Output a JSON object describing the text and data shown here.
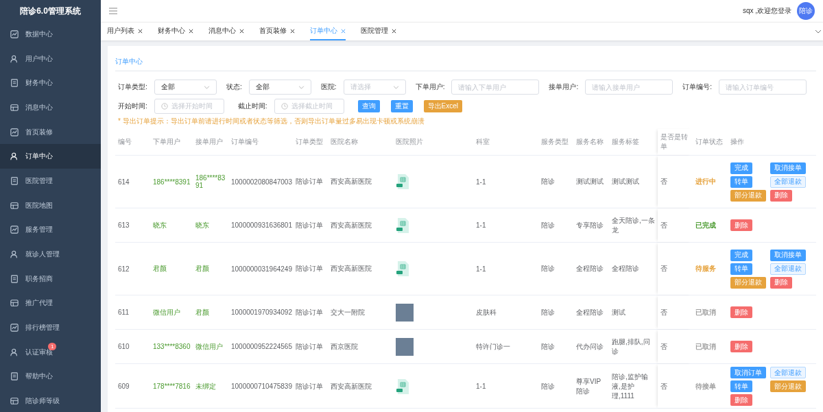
{
  "app_title": "陪诊6.0管理系统",
  "sidebar": {
    "items": [
      {
        "label": "数据中心",
        "selected": false
      },
      {
        "label": "用户中心",
        "selected": false
      },
      {
        "label": "财务中心",
        "selected": false
      },
      {
        "label": "消息中心",
        "selected": false
      },
      {
        "label": "首页装修",
        "selected": false
      },
      {
        "label": "订单中心",
        "selected": true
      },
      {
        "label": "医院管理",
        "selected": false
      },
      {
        "label": "医院地图",
        "selected": false
      },
      {
        "label": "服务管理",
        "selected": false
      },
      {
        "label": "就诊人管理",
        "selected": false
      },
      {
        "label": "职务招商",
        "selected": false
      },
      {
        "label": "推广代理",
        "selected": false
      },
      {
        "label": "排行榜管理",
        "selected": false
      },
      {
        "label": "认证审核",
        "selected": false,
        "badge": "1"
      },
      {
        "label": "帮助中心",
        "selected": false
      },
      {
        "label": "陪诊师等级",
        "selected": false
      }
    ]
  },
  "header": {
    "greeting": "sqx ,欢迎您登录",
    "avatar_text": "陪诊"
  },
  "tabs": [
    {
      "label": "用户列表",
      "selected": false
    },
    {
      "label": "财务中心",
      "selected": false
    },
    {
      "label": "消息中心",
      "selected": false
    },
    {
      "label": "首页装修",
      "selected": false
    },
    {
      "label": "订单中心",
      "selected": true
    },
    {
      "label": "医院管理",
      "selected": false
    }
  ],
  "card_title": "订单中心",
  "filters": {
    "row1": [
      {
        "label": "订单类型:",
        "kind": "select",
        "value": "全部"
      },
      {
        "label": "状态:",
        "kind": "select",
        "value": "全部"
      },
      {
        "label": "医院:",
        "kind": "select",
        "placeholder": "请选择"
      },
      {
        "label": "下单用户:",
        "kind": "input",
        "placeholder": "请输入下单用户"
      },
      {
        "label": "接单用户:",
        "kind": "input",
        "placeholder": "请输入接单用户"
      },
      {
        "label": "订单编号:",
        "kind": "input",
        "placeholder": "请输入订单编号"
      }
    ],
    "row2": [
      {
        "label": "开始时间:",
        "kind": "date",
        "placeholder": "选择开始时间"
      },
      {
        "label": "截止时间:",
        "kind": "date",
        "placeholder": "选择截止时间"
      }
    ],
    "buttons": [
      {
        "label": "查询",
        "kind": "primary"
      },
      {
        "label": "重置",
        "kind": "primary"
      },
      {
        "label": "导出Excel",
        "kind": "warning"
      }
    ],
    "tip": "* 导出订单提示：导出订单前请进行时间或者状态等筛选，否则导出订单量过多易出现卡顿或系统崩溃"
  },
  "table": {
    "columns": [
      "编号",
      "下单用户",
      "接单用户",
      "订单编号",
      "订单类型",
      "医院名称",
      "医院照片",
      "科室",
      "服务类型",
      "服务名称",
      "服务标签",
      "是否是转单",
      "订单状态",
      "操作"
    ],
    "rows": [
      {
        "id": "614",
        "buyer": "186****8391",
        "taker": "186****8391",
        "order_no": "1000002080847003",
        "type": "陪诊订单",
        "hospital": "西安高新医院",
        "photo": {
          "kind": "file"
        },
        "dept": "1-1",
        "service_type": "陪诊",
        "service_name": "测试测试",
        "tags": "测试测试",
        "transfer": "否",
        "status": {
          "text": "进行中",
          "color": "#e6a23c"
        },
        "actions": [
          {
            "label": "完成",
            "kind": "primary"
          },
          {
            "label": "取消接单",
            "kind": "primary"
          },
          {
            "label": "转单",
            "kind": "primary"
          },
          {
            "label": "全部退款",
            "kind": "plain"
          },
          {
            "label": "部分退款",
            "kind": "warning"
          },
          {
            "label": "删除",
            "kind": "danger"
          }
        ]
      },
      {
        "id": "613",
        "buyer": "晓东",
        "taker": "晓东",
        "order_no": "1000000931636801",
        "type": "陪诊订单",
        "hospital": "西安高新医院",
        "photo": {
          "kind": "file"
        },
        "dept": "1-1",
        "service_type": "陪诊",
        "service_name": "专享陪诊",
        "tags": "全天陪诊,一条龙",
        "transfer": "否",
        "status": {
          "text": "已完成",
          "color": "#4a9a2e"
        },
        "actions": [
          {
            "label": "删除",
            "kind": "danger"
          }
        ]
      },
      {
        "id": "612",
        "buyer": "君颜",
        "taker": "君颜",
        "order_no": "1000000031964249",
        "type": "陪诊订单",
        "hospital": "西安高新医院",
        "photo": {
          "kind": "file"
        },
        "dept": "1-1",
        "service_type": "陪诊",
        "service_name": "全程陪诊",
        "tags": "全程陪诊",
        "transfer": "否",
        "status": {
          "text": "待服务",
          "color": "#e6a23c"
        },
        "actions": [
          {
            "label": "完成",
            "kind": "primary"
          },
          {
            "label": "取消接单",
            "kind": "primary"
          },
          {
            "label": "转单",
            "kind": "primary"
          },
          {
            "label": "全部退款",
            "kind": "plain"
          },
          {
            "label": "部分退款",
            "kind": "warning"
          },
          {
            "label": "删除",
            "kind": "danger"
          }
        ]
      },
      {
        "id": "611",
        "buyer": "微信用户",
        "taker": "君颜",
        "order_no": "1000001970934092",
        "type": "陪诊订单",
        "hospital": "交大一附院",
        "photo": {
          "kind": "photo"
        },
        "dept": "皮肤科",
        "service_type": "陪诊",
        "service_name": "全程陪诊",
        "tags": "测试",
        "transfer": "否",
        "status": {
          "text": "已取消",
          "color": "#a0a0a0"
        },
        "actions": [
          {
            "label": "删除",
            "kind": "danger"
          }
        ]
      },
      {
        "id": "610",
        "buyer": "133****8360",
        "taker": "微信用户",
        "order_no": "1000000952224565",
        "type": "陪诊订单",
        "hospital": "西京医院",
        "photo": {
          "kind": "photo"
        },
        "dept": "特许门诊一",
        "service_type": "陪诊",
        "service_name": "代办问诊",
        "tags": "跑腿,排队,问诊",
        "transfer": "否",
        "status": {
          "text": "已取消",
          "color": "#a0a0a0"
        },
        "actions": [
          {
            "label": "删除",
            "kind": "danger"
          }
        ]
      },
      {
        "id": "609",
        "buyer": "178****7816",
        "taker": "未绑定",
        "order_no": "1000000710475839",
        "type": "陪诊订单",
        "hospital": "西安高新医院",
        "photo": {
          "kind": "file"
        },
        "dept": "1-1",
        "service_type": "陪诊",
        "service_name": "尊享VIP陪诊",
        "tags": "陪诊,监护输液,是护理,1111",
        "transfer": "否",
        "status": {
          "text": "待接单",
          "color": "#a0a0a0"
        },
        "actions": [
          {
            "label": "取消订单",
            "kind": "primary"
          },
          {
            "label": "全部退款",
            "kind": "plain"
          },
          {
            "label": "转单",
            "kind": "primary"
          },
          {
            "label": "部分退款",
            "kind": "warning"
          },
          {
            "label": "删除",
            "kind": "danger"
          }
        ]
      }
    ]
  }
}
